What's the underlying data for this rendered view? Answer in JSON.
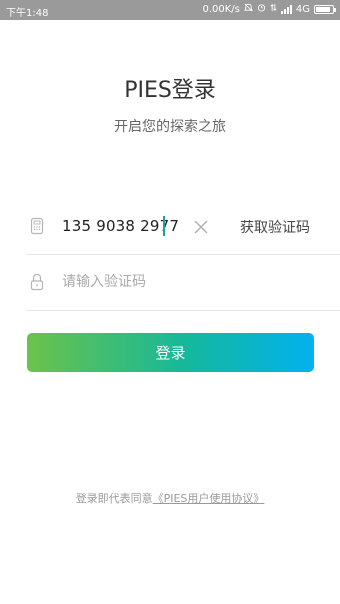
{
  "status_bar": {
    "time": "下午1:48",
    "network_speed": "0.00K/s",
    "network_type": "4G",
    "battery_level": 0.9
  },
  "header": {
    "title": "PIES登录",
    "subtitle": "开启您的探索之旅"
  },
  "form": {
    "phone_value": "135 9038 2977",
    "get_code_label": "获取验证码",
    "code_placeholder": "请输入验证码",
    "code_value": "",
    "login_label": "登录"
  },
  "footer": {
    "agreement_prefix": "登录即代表同意",
    "agreement_link": "《PIES用户使用协议》"
  },
  "colors": {
    "gradient_start": "#6cc24a",
    "gradient_mid": "#15b89b",
    "gradient_end": "#02b2ee",
    "caret": "#1aa3a3"
  }
}
